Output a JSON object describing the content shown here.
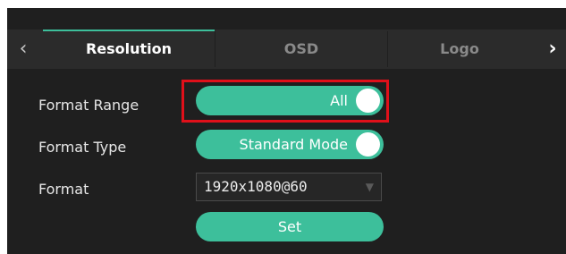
{
  "tabs": {
    "items": [
      {
        "label": "Resolution",
        "active": true
      },
      {
        "label": "OSD",
        "active": false
      },
      {
        "label": "Logo",
        "active": false
      }
    ],
    "prev_icon": "chevron-left-icon",
    "next_icon": "chevron-right-icon"
  },
  "rows": {
    "format_range": {
      "label": "Format Range",
      "value": "All",
      "on": true
    },
    "format_type": {
      "label": "Format Type",
      "value": "Standard Mode",
      "on": true
    },
    "format": {
      "label": "Format",
      "value": "1920x1080@60"
    }
  },
  "set_button": {
    "label": "Set"
  },
  "colors": {
    "accent": "#3dbf9b",
    "highlight": "#e0101a",
    "background": "#1f1f1f"
  }
}
